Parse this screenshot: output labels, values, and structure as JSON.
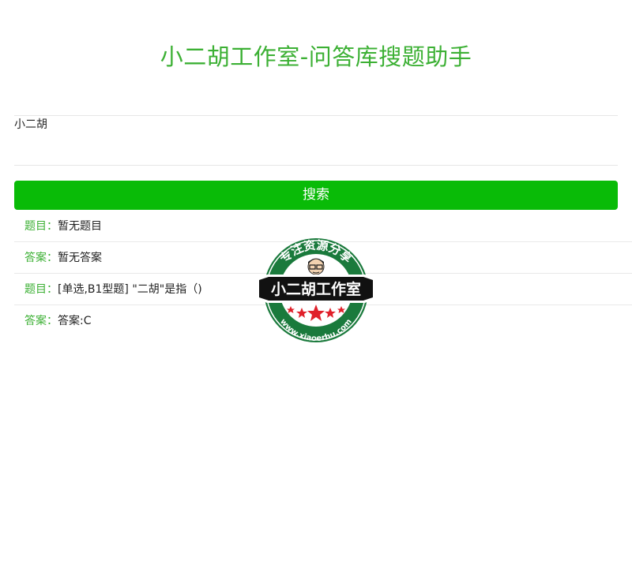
{
  "header": {
    "title": "小二胡工作室-问答库搜题助手"
  },
  "search": {
    "query_value": "小二胡",
    "button_label": "搜索"
  },
  "results": [
    {
      "key": "题目：",
      "value": "暂无题目"
    },
    {
      "key": "答案：",
      "value": "暂无答案"
    },
    {
      "key": "题目：",
      "value": "[单选,B1型题] \"二胡\"是指（)"
    },
    {
      "key": "答案：",
      "value": "答案:C"
    }
  ],
  "watermark": {
    "arc_text": "专注资源分享",
    "banner_text": "小二胡工作室",
    "url_text": "www.xiaoerhu.com"
  },
  "colors": {
    "accent_green": "#3cb034",
    "button_green": "#09bb07",
    "badge_green": "#1a7a3c",
    "star_red": "#e0202a"
  }
}
